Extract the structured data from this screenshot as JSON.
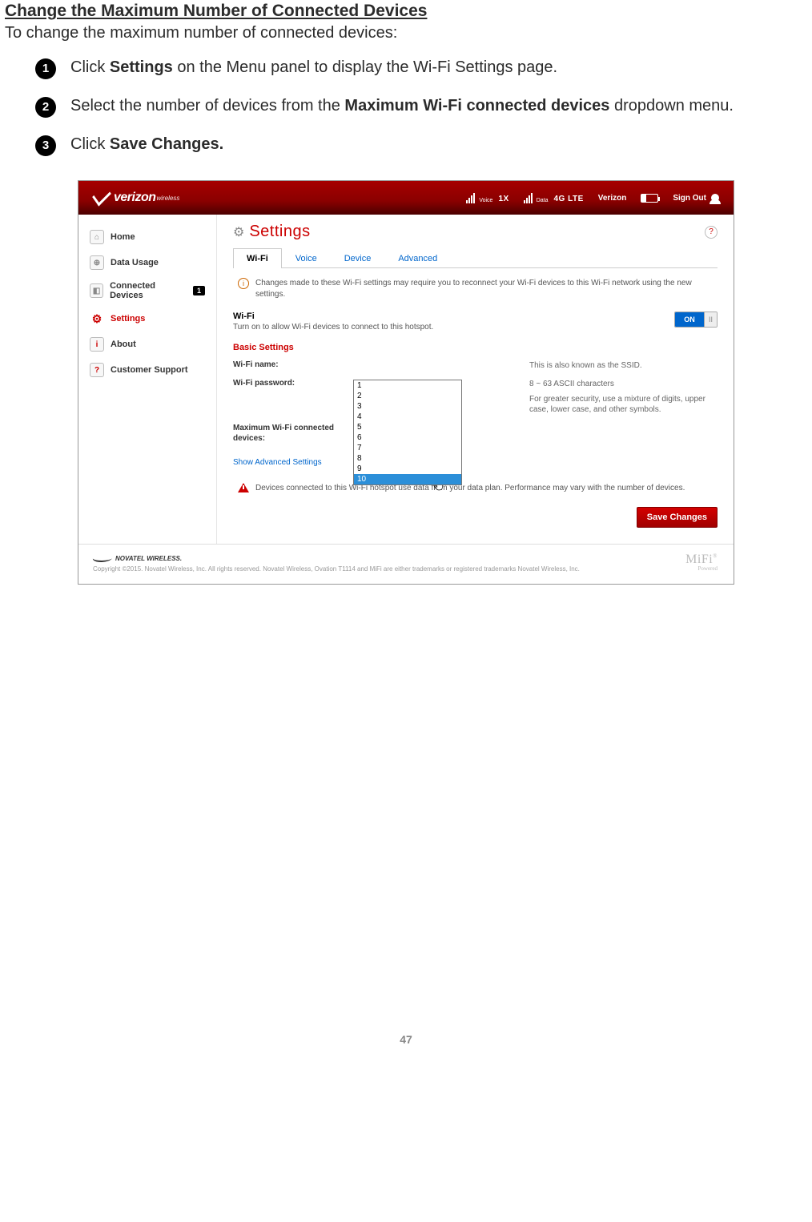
{
  "doc": {
    "title": "Change the Maximum Number of Connected Devices",
    "subtitle": "To change the maximum number of connected devices:",
    "step1_pre": "Click ",
    "step1_b": "Settings",
    "step1_post": " on the Menu panel to display the Wi-Fi Settings page.",
    "step2_pre": "Select the number of devices from the ",
    "step2_b": "Maximum Wi-Fi connected devices",
    "step2_post": " dropdown menu.",
    "step3_pre": "Click ",
    "step3_b": "Save Changes.",
    "page_number": "47"
  },
  "topbar": {
    "brand": "verizon",
    "brand_sub": "wireless",
    "voice_label": "Voice",
    "voice_net": "1X",
    "data_label": "Data",
    "data_net": "4G LTE",
    "carrier": "Verizon",
    "signout": "Sign Out"
  },
  "sidebar": {
    "items": [
      {
        "label": "Home"
      },
      {
        "label": "Data Usage"
      },
      {
        "label": "Connected Devices",
        "badge": "1"
      },
      {
        "label": "Settings"
      },
      {
        "label": "About"
      },
      {
        "label": "Customer Support"
      }
    ]
  },
  "page": {
    "title": "Settings",
    "tabs": [
      "Wi-Fi",
      "Voice",
      "Device",
      "Advanced"
    ],
    "info": "Changes made to these Wi-Fi settings may require you to reconnect your Wi-Fi devices to this Wi-Fi network using the new settings.",
    "wifi_h": "Wi-Fi",
    "wifi_sub": "Turn on to allow Wi-Fi devices to connect to this hotspot.",
    "toggle_on": "ON",
    "toggle_knob": "II",
    "basic_h": "Basic Settings",
    "name_label": "Wi-Fi name:",
    "name_help": "This is also known as the SSID.",
    "pass_label": "Wi-Fi password:",
    "pass_help1": "8 ~ 63 ASCII characters",
    "pass_help2": "For greater security, use a mixture of digits, upper case, lower case, and other symbols.",
    "max_label": "Maximum Wi-Fi connected devices:",
    "dropdown": [
      "1",
      "2",
      "3",
      "4",
      "5",
      "6",
      "7",
      "8",
      "9",
      "10"
    ],
    "dropdown_selected": "10",
    "adv_link": "Show Advanced Settings",
    "warn": "Devices connected to this Wi-Fi hotspot use data from your data plan. Performance may vary with the number of devices.",
    "save": "Save Changes"
  },
  "footer": {
    "brand": "NOVATEL WIRELESS.",
    "copy": "Copyright ©2015. Novatel Wireless, Inc. All rights reserved. Novatel Wireless, Ovation T1114 and MiFi are either trademarks or registered trademarks Novatel Wireless, Inc.",
    "mifi": "MiFi",
    "mifi_sub": "Powered",
    "reg": "®"
  }
}
